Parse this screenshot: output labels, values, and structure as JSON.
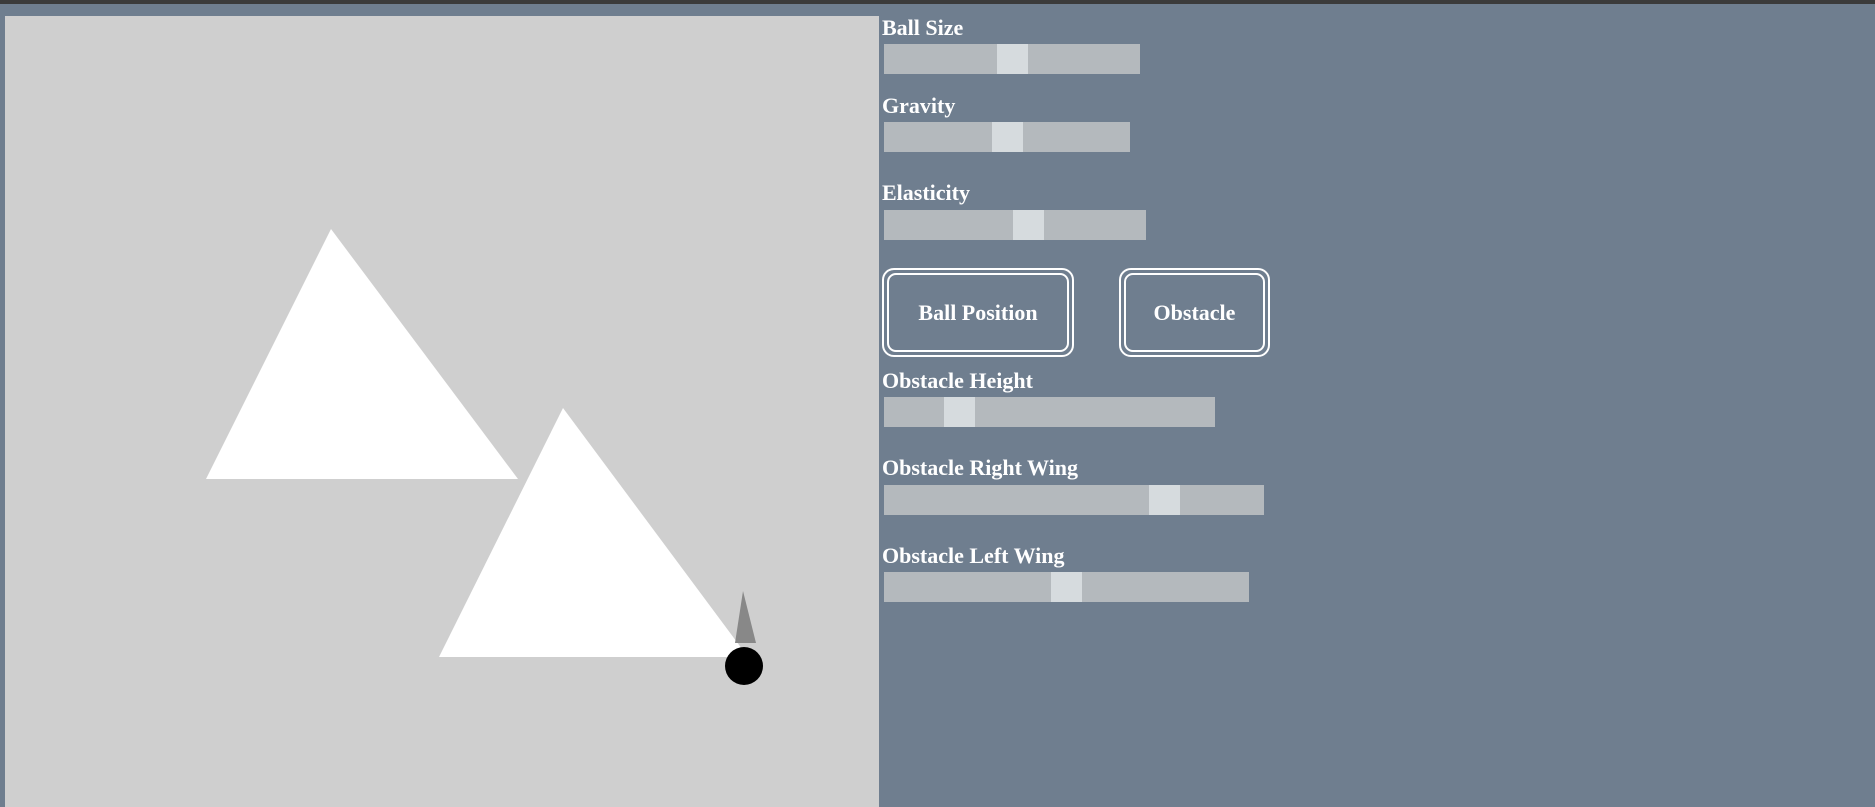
{
  "canvas": {
    "background": "#cfcfcf",
    "shape_color": "#ffffff",
    "ball_color": "#000000",
    "pointer_color": "#888888"
  },
  "controls": {
    "ball_size": {
      "label": "Ball Size",
      "value": 0.5
    },
    "gravity": {
      "label": "Gravity",
      "value": 0.5
    },
    "elasticity": {
      "label": "Elasticity",
      "value": 0.56
    },
    "obstacle_height": {
      "label": "Obstacle Height",
      "value": 0.2
    },
    "obstacle_right_wing": {
      "label": "Obstacle Right Wing",
      "value": 0.76
    },
    "obstacle_left_wing": {
      "label": "Obstacle Left Wing",
      "value": 0.5
    }
  },
  "buttons": {
    "ball_position": "Ball Position",
    "obstacle": "Obstacle"
  },
  "colors": {
    "panel_background": "#6f7e8f",
    "slider_track": "#b4b9bd",
    "slider_thumb": "#d6dbde"
  }
}
